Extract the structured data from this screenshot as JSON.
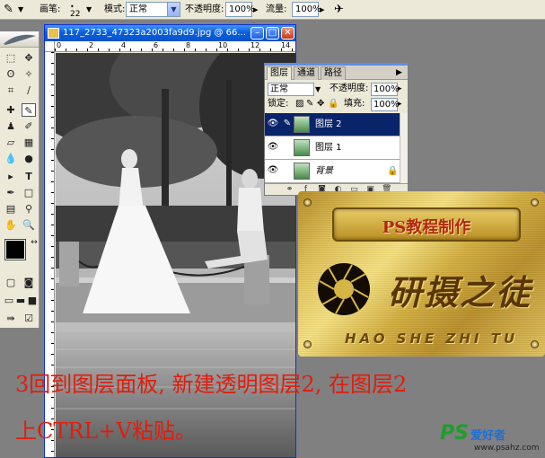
{
  "options_bar": {
    "brush_label": "画笔:",
    "brush_size": "22",
    "mode_label": "模式:",
    "mode_value": "正常",
    "opacity_label": "不透明度:",
    "opacity_value": "100%",
    "flow_label": "流量:",
    "flow_value": "100%"
  },
  "document": {
    "title": "117_2733_47323a2003fa9d9.jpg @ 66...",
    "ruler_labels": [
      "0",
      "2",
      "4",
      "6",
      "8",
      "10",
      "12",
      "14"
    ]
  },
  "layers_panel": {
    "tabs": [
      "图层",
      "通道",
      "路径"
    ],
    "blend_mode": "正常",
    "opacity_label": "不透明度:",
    "opacity_value": "100%",
    "lock_label": "锁定:",
    "fill_label": "填充:",
    "fill_value": "100%",
    "layers": [
      {
        "name": "图层 2",
        "selected": true
      },
      {
        "name": "图层 1",
        "selected": false
      },
      {
        "name": "背景",
        "selected": false
      }
    ]
  },
  "plate": {
    "title": "PS教程制作",
    "logo_text": "研摄之徒",
    "subtitle": "HAO SHE ZHI TU"
  },
  "caption": {
    "line1": "3回到图层面板, 新建透明图层2, 在图层2",
    "line2": "上CTRL+V粘贴。"
  },
  "watermark": {
    "logo": "PS",
    "name": "爱好者",
    "url": "www.psahz.com"
  },
  "colors": {
    "caption": "#e21c0c",
    "title_bar": "#0a5fdf",
    "selected_layer": "#0a246a"
  }
}
